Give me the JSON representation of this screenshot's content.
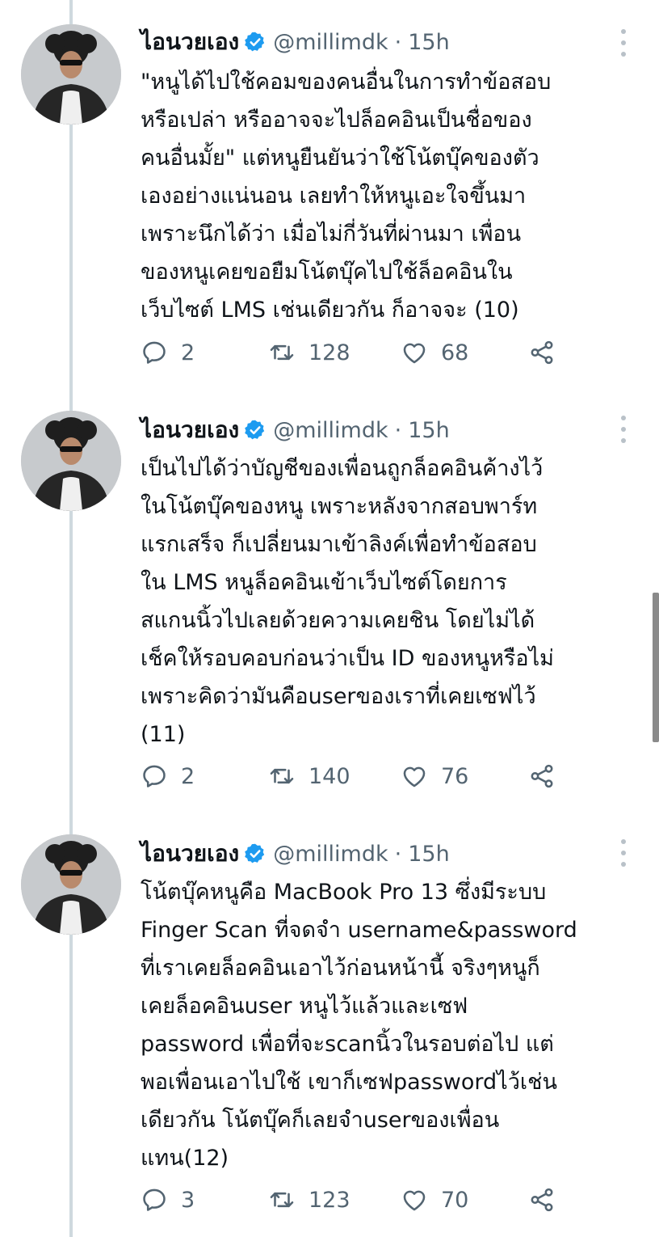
{
  "author": {
    "display_name": "ไอนวยเอง",
    "handle": "@millimdk",
    "separator": "·",
    "verified_icon": "verified-badge-icon"
  },
  "colors": {
    "text": "#0f1419",
    "secondary": "#536471",
    "verified": "#1d9bf0",
    "thread_line": "#cfd9de"
  },
  "tweets": [
    {
      "time": "15h",
      "text": "\"หนูได้ไปใช้คอมของคนอื่นในการทำข้อสอบ\nหรือเปล่า หรืออาจจะไปล็อคอินเป็นชื่อของ\nคนอื่นมั้ย\" แต่หนูยืนยันว่าใช้โน้ตบุ๊คของตัว\nเองอย่างแน่นอน เลยทำให้หนูเอะใจขึ้นมา\nเพราะนึกได้ว่า เมื่อไม่กี่วันที่ผ่านมา เพื่อน\nของหนูเคยขอยืมโน้ตบุ๊คไปใช้ล็อคอินใน\nเว็บไซต์ LMS เช่นเดียวกัน ก็อาจจะ (10)",
      "replies": "2",
      "retweets": "128",
      "likes": "68"
    },
    {
      "time": "15h",
      "text": "เป็นไปได้ว่าบัญชีของเพื่อนถูกล็อคอินค้างไว้\nในโน้ตบุ๊คของหนู เพราะหลังจากสอบพาร์ท\nแรกเสร็จ ก็เปลี่ยนมาเข้าลิงค์เพื่อทำข้อสอบ\nใน LMS หนูล็อคอินเข้าเว็บไซต์โดยการ\nสแกนนิ้วไปเลยด้วยความเคยชิน โดยไม่ได้\nเช็คให้รอบคอบก่อนว่าเป็น ID ของหนูหรือไม่\nเพราะคิดว่ามันคือuserของเราที่เคยเซฟไว้\n(11)",
      "replies": "2",
      "retweets": "140",
      "likes": "76"
    },
    {
      "time": "15h",
      "text": "โน้ตบุ๊คหนูคือ MacBook Pro 13 ซึ่งมีระบบ\nFinger Scan ที่จดจำ username&password\nที่เราเคยล็อคอินเอาไว้ก่อนหน้านี้ จริงๆหนูก็\nเคยล็อคอินuser หนูไว้แล้วและเซฟ\npassword เพื่อที่จะscanนิ้วในรอบต่อไป แต่\nพอเพื่อนเอาไปใช้ เขาก็เซฟpasswordไว้เช่น\nเดียวกัน โน้ตบุ๊คก็เลยจำuserของเพื่อน\nแทน(12)",
      "replies": "3",
      "retweets": "123",
      "likes": "70"
    }
  ]
}
